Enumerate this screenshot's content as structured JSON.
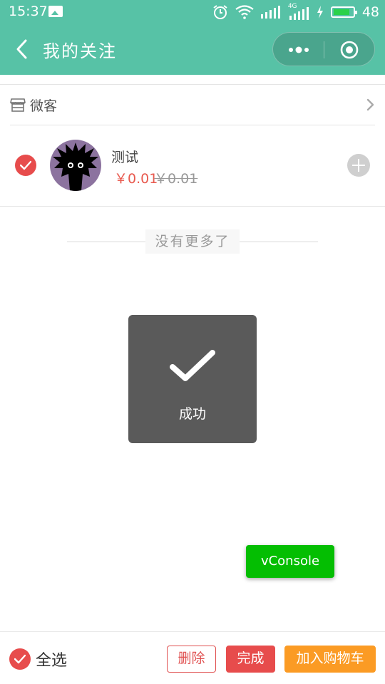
{
  "status_bar": {
    "time": "15:37",
    "battery_level": "48",
    "battery_charge_fraction": 0.48,
    "signal_label": "4G",
    "icons": [
      "image-notification-icon",
      "alarm-icon",
      "wifi-icon",
      "signal-icon",
      "charging-icon",
      "battery-icon"
    ]
  },
  "nav": {
    "title": "我的关注",
    "back_icon": "chevron-left-icon",
    "more_icon": "more-dots-icon",
    "close_icon": "target-close-icon"
  },
  "shop": {
    "name": "微客",
    "icon": "store-icon"
  },
  "item": {
    "name": "测试",
    "price": "￥0.01",
    "original_price": "￥0.01",
    "checked": true
  },
  "list_end_text": "没有更多了",
  "toast": {
    "text": "成功",
    "icon": "checkmark-icon"
  },
  "vconsole_label": "vConsole",
  "bottom_bar": {
    "select_all_label": "全选",
    "delete_label": "删除",
    "done_label": "完成",
    "add_to_cart_label": "加入购物车"
  },
  "colors": {
    "header": "#57c2a6",
    "accent_red": "#e74c4c",
    "cart_orange": "#fb9b24",
    "vconsole_green": "#04be02",
    "toast_bg": "#5a5a5a"
  }
}
